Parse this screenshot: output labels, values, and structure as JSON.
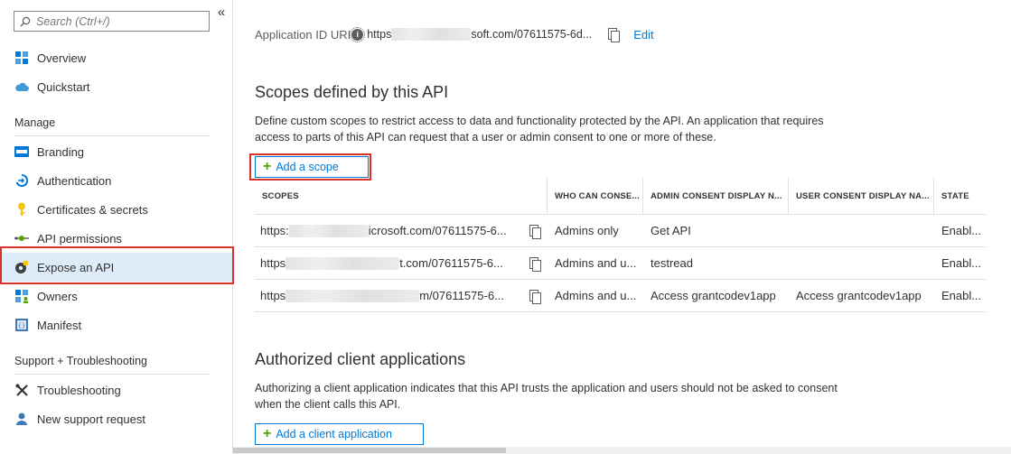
{
  "sidebar": {
    "search_placeholder": "Search (Ctrl+/)",
    "collapse_glyph": "«",
    "items_top": [
      {
        "label": "Overview",
        "icon": "overview-grid-icon"
      },
      {
        "label": "Quickstart",
        "icon": "cloud-icon"
      }
    ],
    "manage_header": "Manage",
    "manage_items": [
      {
        "label": "Branding",
        "icon": "branding-icon"
      },
      {
        "label": "Authentication",
        "icon": "authentication-icon"
      },
      {
        "label": "Certificates & secrets",
        "icon": "key-icon"
      },
      {
        "label": "API permissions",
        "icon": "api-permissions-icon"
      },
      {
        "label": "Expose an API",
        "icon": "expose-api-icon",
        "active": true
      },
      {
        "label": "Owners",
        "icon": "owners-icon"
      },
      {
        "label": "Manifest",
        "icon": "manifest-icon"
      }
    ],
    "support_header": "Support + Troubleshooting",
    "support_items": [
      {
        "label": "Troubleshooting",
        "icon": "tools-icon"
      },
      {
        "label": "New support request",
        "icon": "support-person-icon"
      }
    ]
  },
  "main": {
    "app_id": {
      "label": "Application ID URI",
      "value_prefix": "https",
      "value_suffix": "soft.com/07611575-6d...",
      "edit_label": "Edit"
    },
    "scopes": {
      "title": "Scopes defined by this API",
      "description": "Define custom scopes to restrict access to data and functionality protected by the API. An application that requires access to parts of this API can request that a user or admin consent to one or more of these.",
      "add_button": "Add a scope",
      "columns": [
        "SCOPES",
        "WHO CAN CONSE...",
        "ADMIN CONSENT DISPLAY N...",
        "USER CONSENT DISPLAY NA...",
        "STATE"
      ],
      "rows": [
        {
          "uri_prefix": "https:",
          "uri_suffix": "icrosoft.com/07611575-6...",
          "who": "Admins only",
          "admin_display": "Get API",
          "user_display": "",
          "state": "Enabl..."
        },
        {
          "uri_prefix": "https",
          "uri_suffix": "t.com/07611575-6...",
          "who": "Admins and u...",
          "admin_display": "testread",
          "user_display": "",
          "state": "Enabl..."
        },
        {
          "uri_prefix": "https",
          "uri_suffix": "m/07611575-6...",
          "who": "Admins and u...",
          "admin_display": "Access grantcodev1app",
          "user_display": "Access grantcodev1app",
          "state": "Enabl..."
        }
      ]
    },
    "authorized": {
      "title": "Authorized client applications",
      "description": "Authorizing a client application indicates that this API trusts the application and users should not be asked to consent when the client calls this API.",
      "add_button": "Add a client application"
    }
  },
  "colors": {
    "accent": "#0078d4",
    "active_nav_bg": "#deecf9",
    "highlight_red": "#d9302c",
    "plus_green": "#57a300"
  }
}
